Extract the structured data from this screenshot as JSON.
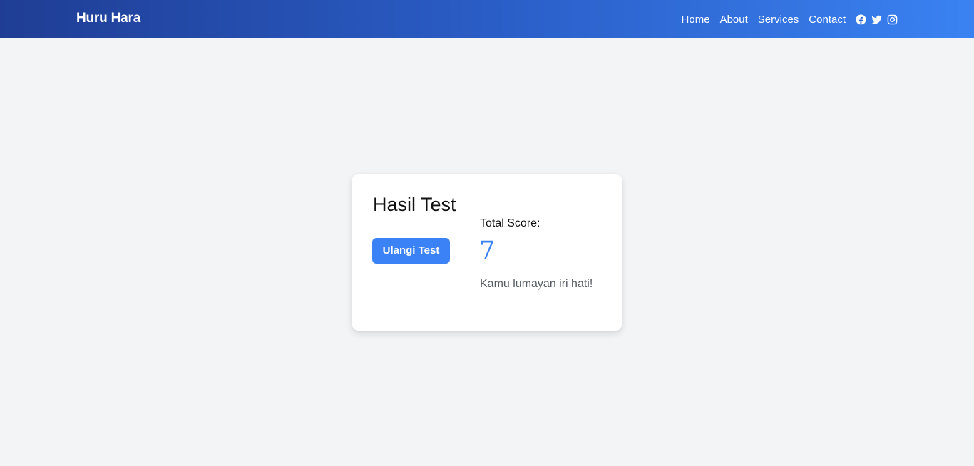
{
  "navbar": {
    "brand": "Huru Hara",
    "links": [
      {
        "label": "Home"
      },
      {
        "label": "About"
      },
      {
        "label": "Services"
      },
      {
        "label": "Contact"
      }
    ],
    "social_icons": [
      "facebook-icon",
      "twitter-icon",
      "instagram-icon"
    ]
  },
  "result_card": {
    "title": "Hasil Test",
    "retry_button_label": "Ulangi Test",
    "score_label": "Total Score:",
    "score_value": "7",
    "message": "Kamu lumayan iri hati!"
  },
  "colors": {
    "nav_gradient_start": "#1f3d94",
    "nav_gradient_end": "#3a82f2",
    "accent": "#3b82f6",
    "page_background": "#f2f4f6",
    "card_background": "#ffffff"
  }
}
